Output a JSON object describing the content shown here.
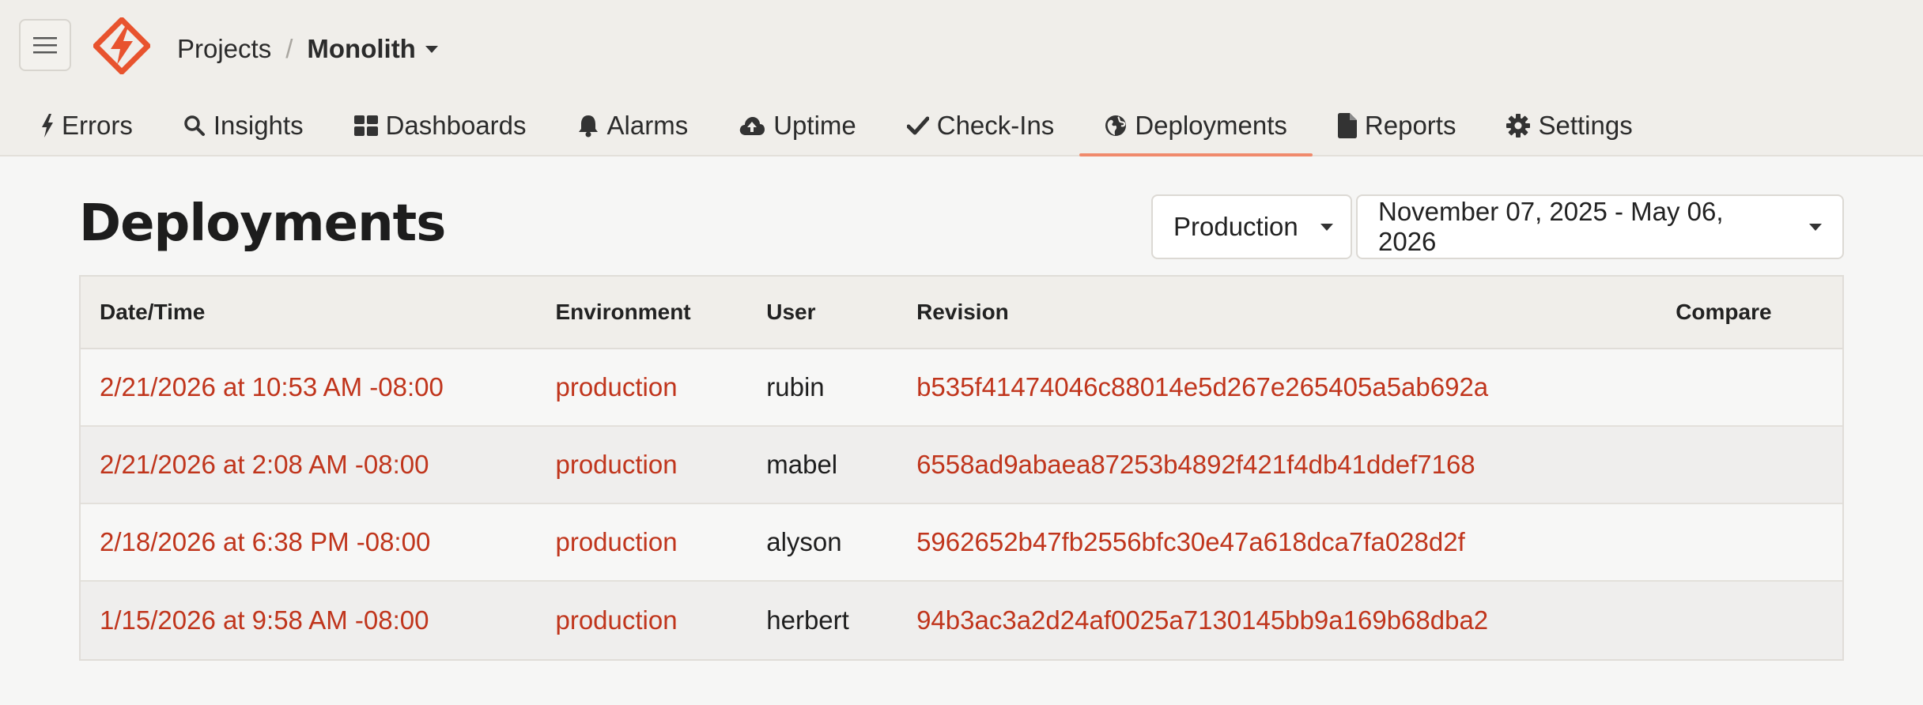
{
  "header": {
    "breadcrumb": {
      "projects": "Projects",
      "separator": "/",
      "current": "Monolith"
    }
  },
  "tabs": [
    {
      "label": "Errors",
      "icon": "bolt-icon"
    },
    {
      "label": "Insights",
      "icon": "search-icon"
    },
    {
      "label": "Dashboards",
      "icon": "grid-icon"
    },
    {
      "label": "Alarms",
      "icon": "bell-icon"
    },
    {
      "label": "Uptime",
      "icon": "cloud-upload-icon"
    },
    {
      "label": "Check-Ins",
      "icon": "check-icon"
    },
    {
      "label": "Deployments",
      "icon": "globe-icon",
      "active": true
    },
    {
      "label": "Reports",
      "icon": "file-icon"
    },
    {
      "label": "Settings",
      "icon": "gear-icon"
    }
  ],
  "main": {
    "title": "Deployments",
    "environment_filter": "Production",
    "date_range_filter": "November 07, 2025 - May 06, 2026"
  },
  "table": {
    "columns": [
      "Date/Time",
      "Environment",
      "User",
      "Revision",
      "Compare"
    ],
    "rows": [
      {
        "datetime": "2/21/2026 at 10:53 AM -08:00",
        "environment": "production",
        "user": "rubin",
        "revision": "b535f41474046c88014e5d267e265405a5ab692a"
      },
      {
        "datetime": "2/21/2026 at 2:08 AM -08:00",
        "environment": "production",
        "user": "mabel",
        "revision": "6558ad9abaea87253b4892f421f4db41ddef7168"
      },
      {
        "datetime": "2/18/2026 at 6:38 PM -08:00",
        "environment": "production",
        "user": "alyson",
        "revision": "5962652b47fb2556bfc30e47a618dca7fa028d2f"
      },
      {
        "datetime": "1/15/2026 at 9:58 AM -08:00",
        "environment": "production",
        "user": "herbert",
        "revision": "94b3ac3a2d24af0025a7130145bb9a169b68dba2"
      }
    ]
  },
  "colors": {
    "accent": "#e8532e",
    "link": "#c0351c",
    "active_tab_underline": "#f08a6c"
  }
}
